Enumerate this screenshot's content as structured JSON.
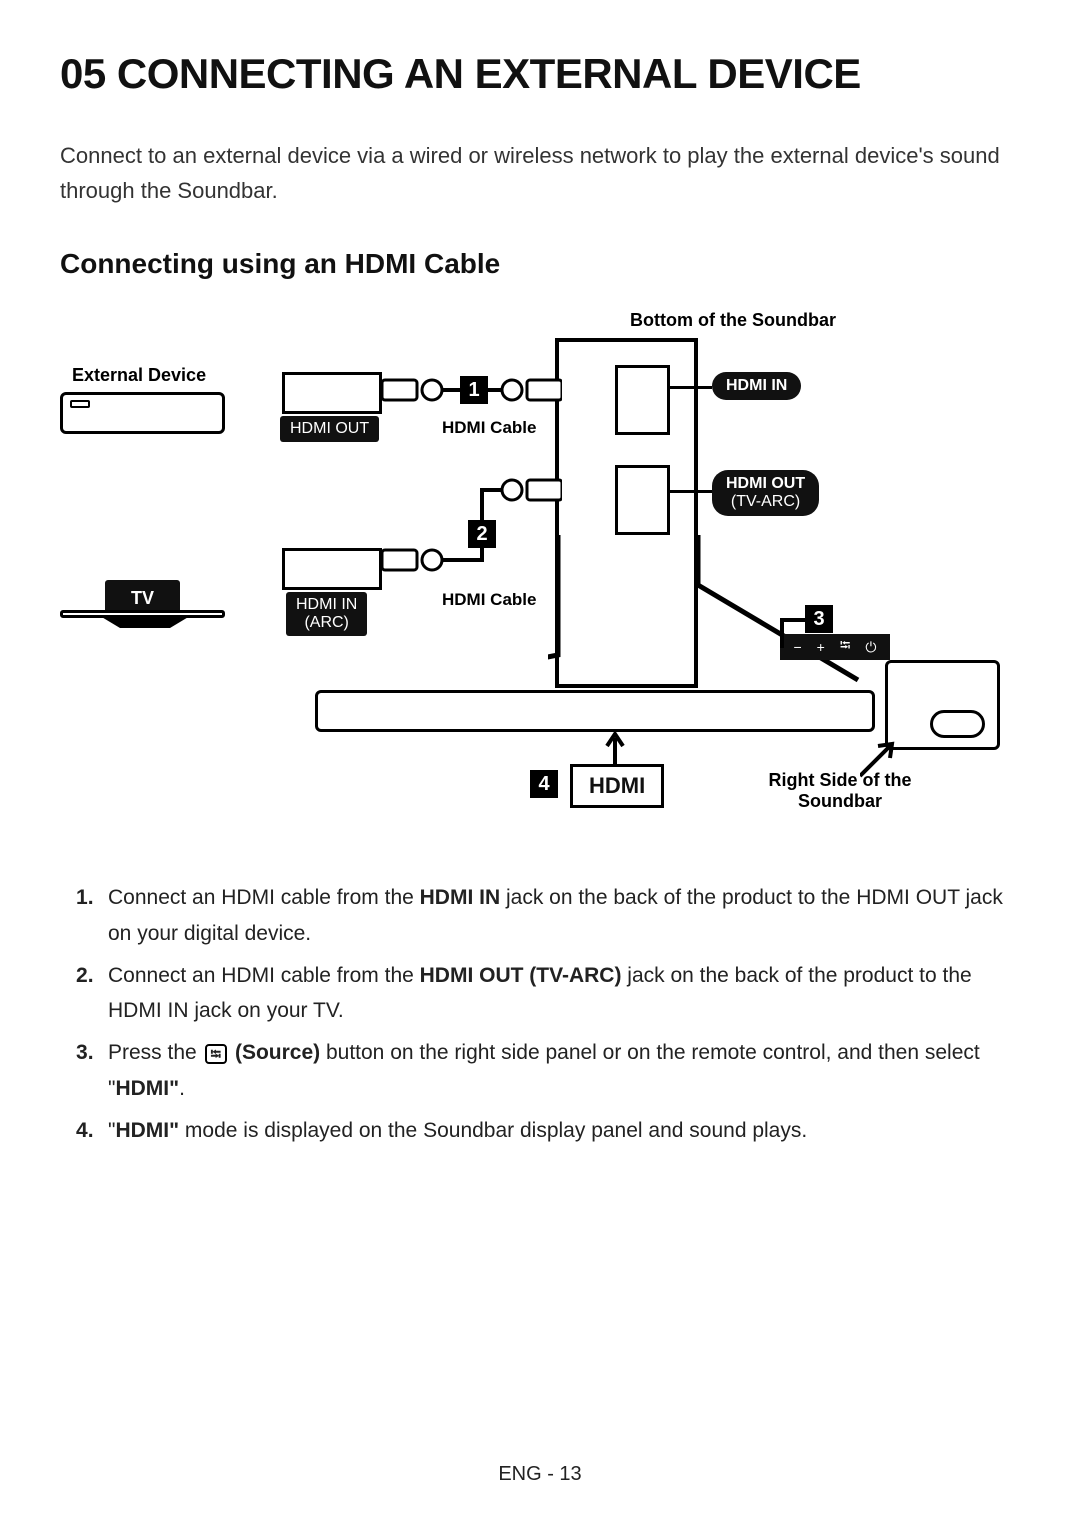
{
  "title": "05   CONNECTING AN EXTERNAL DEVICE",
  "intro": "Connect to an external device via a wired or wireless network to play the external device's sound through the Soundbar.",
  "subtitle": "Connecting using an HDMI Cable",
  "diagram": {
    "top_caption": "Bottom of the Soundbar",
    "external_device": "External Device",
    "hdmi_out": "HDMI OUT",
    "hdmi_cable_1": "HDMI Cable",
    "hdmi_in_pill": "HDMI IN",
    "tv": "TV",
    "hdmi_in_arc_l1": "HDMI IN",
    "hdmi_in_arc_l2": "(ARC)",
    "hdmi_cable_2": "HDMI Cable",
    "hdmi_out_tvarc_l1": "HDMI OUT",
    "hdmi_out_tvarc_l2": "(TV-ARC)",
    "hdmi_display": "HDMI",
    "right_side_l1": "Right Side of the",
    "right_side_l2": "Soundbar",
    "marker1": "1",
    "marker2": "2",
    "marker3": "3",
    "marker4": "4"
  },
  "steps": {
    "s1_a": "Connect an HDMI cable from the ",
    "s1_b": "HDMI IN",
    "s1_c": " jack on the back of the product to the HDMI OUT jack on your digital device.",
    "s2_a": "Connect an HDMI cable from the ",
    "s2_b": "HDMI OUT (TV-ARC)",
    "s2_c": " jack on the back of the product to the HDMI IN jack on your TV.",
    "s3_a": "Press the ",
    "s3_b": "(Source)",
    "s3_c": " button on the right side panel or on the remote control, and then select \"",
    "s3_d": "HDMI\"",
    "s3_e": ".",
    "s4_a": "\"",
    "s4_b": "HDMI\"",
    "s4_c": " mode is displayed on the Soundbar display panel and sound plays."
  },
  "footer": "ENG - 13"
}
